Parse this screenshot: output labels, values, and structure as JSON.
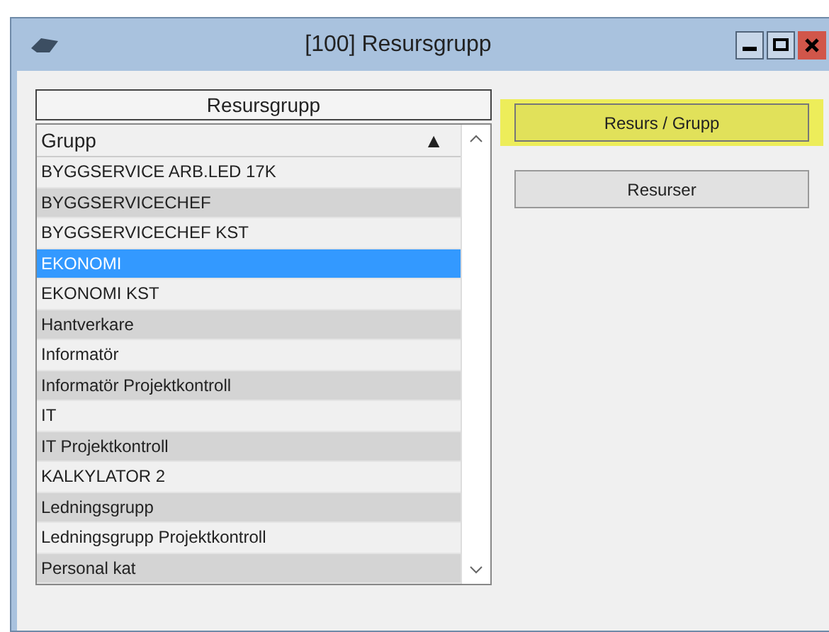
{
  "window": {
    "title": "[100]  Resursgrupp"
  },
  "list": {
    "title": "Resursgrupp",
    "column": {
      "label": "Grupp",
      "sort": "▲"
    },
    "rows": [
      {
        "label": "BYGGSERVICE ARB.LED 17K",
        "selected": false
      },
      {
        "label": "BYGGSERVICECHEF",
        "selected": false
      },
      {
        "label": "BYGGSERVICECHEF KST",
        "selected": false
      },
      {
        "label": "EKONOMI",
        "selected": true
      },
      {
        "label": "EKONOMI KST",
        "selected": false
      },
      {
        "label": "Hantverkare",
        "selected": false
      },
      {
        "label": "Informatör",
        "selected": false
      },
      {
        "label": "Informatör Projektkontroll",
        "selected": false
      },
      {
        "label": "IT",
        "selected": false
      },
      {
        "label": "IT Projektkontroll",
        "selected": false
      },
      {
        "label": "KALKYLATOR 2",
        "selected": false
      },
      {
        "label": "Ledningsgrupp",
        "selected": false
      },
      {
        "label": "Ledningsgrupp Projektkontroll",
        "selected": false
      },
      {
        "label": "Personal kat",
        "selected": false
      }
    ]
  },
  "buttons": [
    {
      "label": "Resurs / Grupp",
      "highlighted": true
    },
    {
      "label": "Resurser",
      "highlighted": false
    }
  ]
}
